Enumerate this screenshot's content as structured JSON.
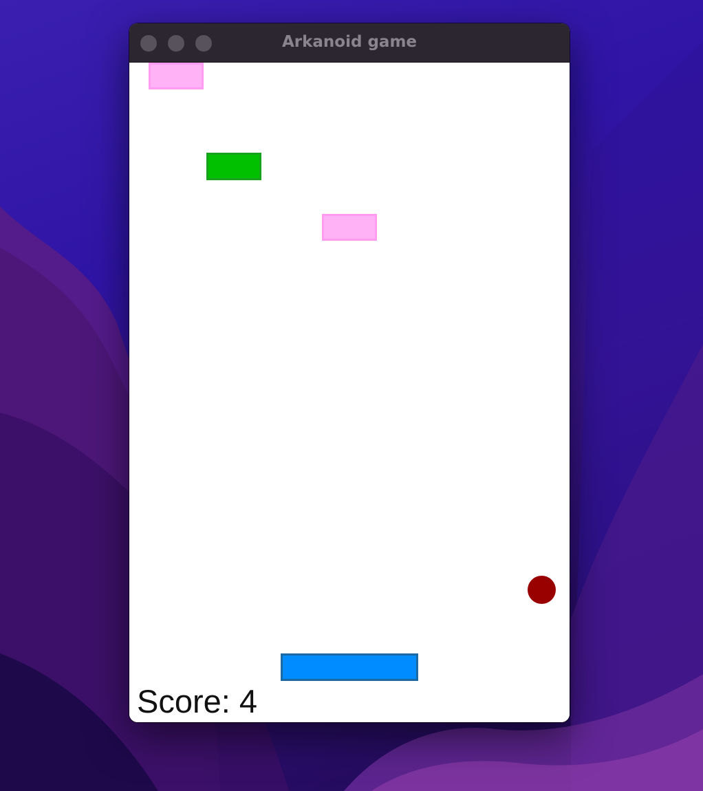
{
  "window": {
    "title": "Arkanoid game"
  },
  "game": {
    "score_label": "Score: 4",
    "bricks": [
      {
        "color": "#ffb3f6",
        "border": "#ff9cf2"
      },
      {
        "color": "#00c000",
        "border": "#16a21c"
      },
      {
        "color": "#ffb3f6",
        "border": "#ff9cf2"
      }
    ],
    "paddle": {
      "color": "#008cff"
    },
    "ball": {
      "color": "#990000"
    }
  },
  "icons": {
    "close": "close-icon",
    "minimize": "minimize-icon",
    "zoom": "zoom-icon"
  }
}
